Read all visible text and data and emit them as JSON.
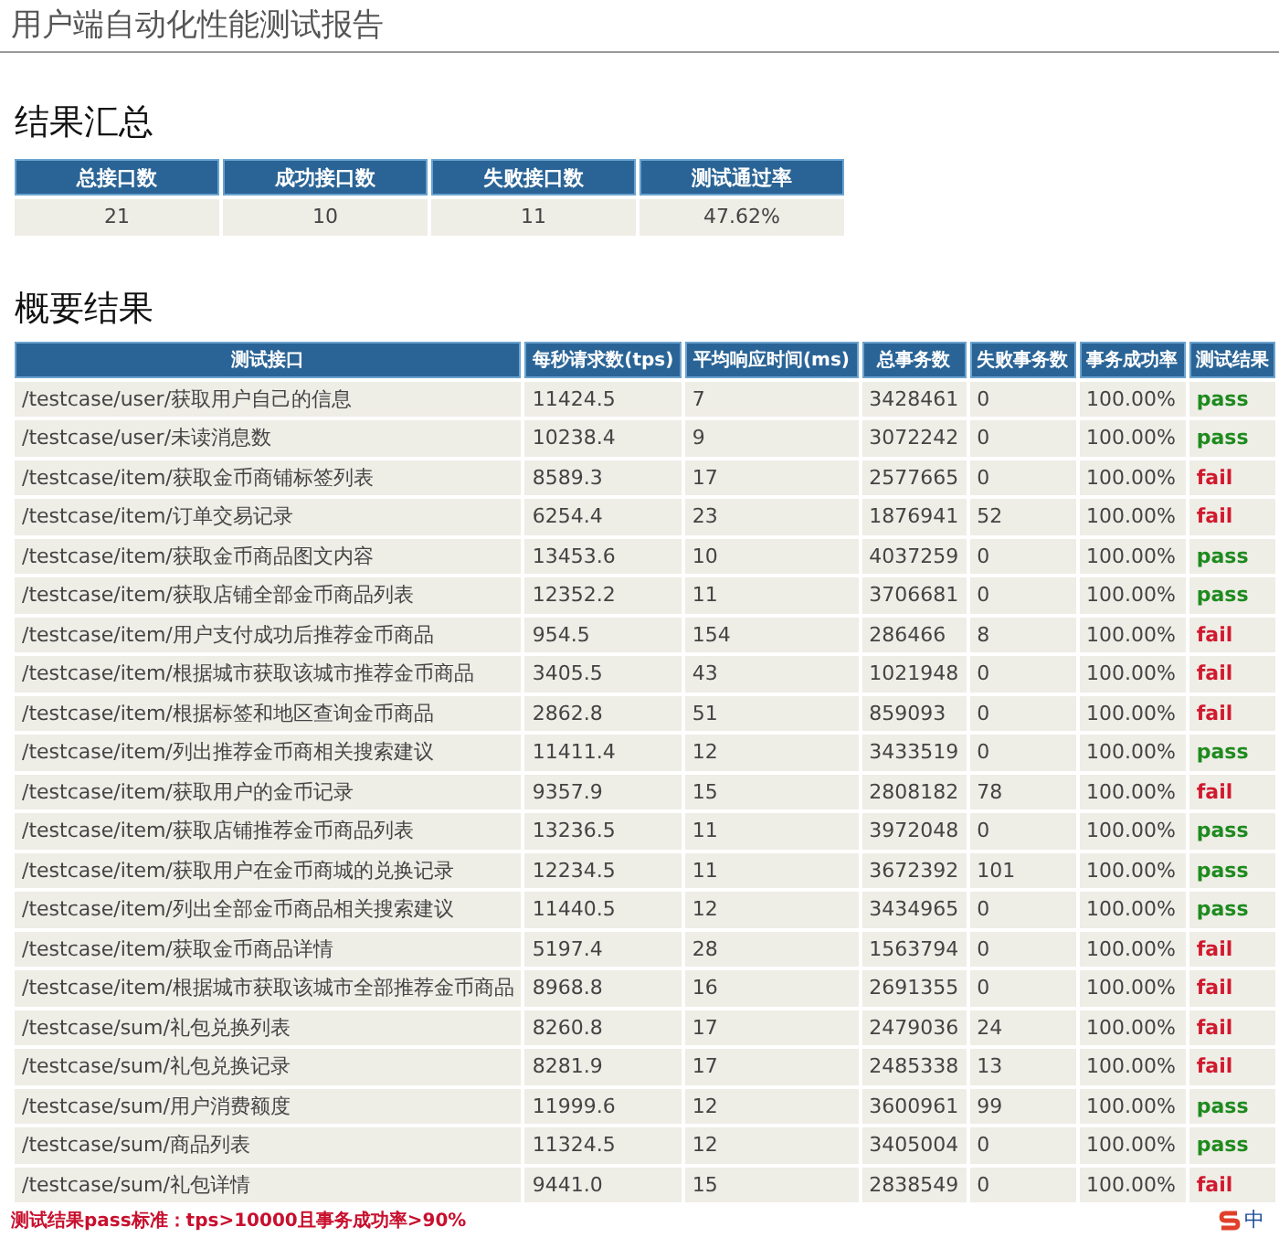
{
  "title": "用户端自动化性能测试报告",
  "summary": {
    "heading": "结果汇总",
    "columns": [
      "总接口数",
      "成功接口数",
      "失败接口数",
      "测试通过率"
    ],
    "values": [
      "21",
      "10",
      "11",
      "47.62%"
    ]
  },
  "details": {
    "heading": "概要结果",
    "columns": [
      "测试接口",
      "每秒请求数(tps)",
      "平均响应时间(ms)",
      "总事务数",
      "失败事务数",
      "事务成功率",
      "测试结果"
    ],
    "rows": [
      {
        "cells": [
          "/testcase/user/获取用户自己的信息",
          "11424.5",
          "7",
          "3428461",
          "0",
          "100.00%"
        ],
        "result": "pass",
        "passed": true
      },
      {
        "cells": [
          "/testcase/user/未读消息数",
          "10238.4",
          "9",
          "3072242",
          "0",
          "100.00%"
        ],
        "result": "pass",
        "passed": true
      },
      {
        "cells": [
          "/testcase/item/获取金币商铺标签列表",
          "8589.3",
          "17",
          "2577665",
          "0",
          "100.00%"
        ],
        "result": "fail",
        "passed": false
      },
      {
        "cells": [
          "/testcase/item/订单交易记录",
          "6254.4",
          "23",
          "1876941",
          "52",
          "100.00%"
        ],
        "result": "fail",
        "passed": false
      },
      {
        "cells": [
          "/testcase/item/获取金币商品图文内容",
          "13453.6",
          "10",
          "4037259",
          "0",
          "100.00%"
        ],
        "result": "pass",
        "passed": true
      },
      {
        "cells": [
          "/testcase/item/获取店铺全部金币商品列表",
          "12352.2",
          "11",
          "3706681",
          "0",
          "100.00%"
        ],
        "result": "pass",
        "passed": true
      },
      {
        "cells": [
          "/testcase/item/用户支付成功后推荐金币商品",
          "954.5",
          "154",
          "286466",
          "8",
          "100.00%"
        ],
        "result": "fail",
        "passed": false
      },
      {
        "cells": [
          "/testcase/item/根据城市获取该城市推荐金币商品",
          "3405.5",
          "43",
          "1021948",
          "0",
          "100.00%"
        ],
        "result": "fail",
        "passed": false
      },
      {
        "cells": [
          "/testcase/item/根据标签和地区查询金币商品",
          "2862.8",
          "51",
          "859093",
          "0",
          "100.00%"
        ],
        "result": "fail",
        "passed": false
      },
      {
        "cells": [
          "/testcase/item/列出推荐金币商相关搜索建议",
          "11411.4",
          "12",
          "3433519",
          "0",
          "100.00%"
        ],
        "result": "pass",
        "passed": true
      },
      {
        "cells": [
          "/testcase/item/获取用户的金币记录",
          "9357.9",
          "15",
          "2808182",
          "78",
          "100.00%"
        ],
        "result": "fail",
        "passed": false
      },
      {
        "cells": [
          "/testcase/item/获取店铺推荐金币商品列表",
          "13236.5",
          "11",
          "3972048",
          "0",
          "100.00%"
        ],
        "result": "pass",
        "passed": true
      },
      {
        "cells": [
          "/testcase/item/获取用户在金币商城的兑换记录",
          "12234.5",
          "11",
          "3672392",
          "101",
          "100.00%"
        ],
        "result": "pass",
        "passed": true
      },
      {
        "cells": [
          "/testcase/item/列出全部金币商品相关搜索建议",
          "11440.5",
          "12",
          "3434965",
          "0",
          "100.00%"
        ],
        "result": "pass",
        "passed": true
      },
      {
        "cells": [
          "/testcase/item/获取金币商品详情",
          "5197.4",
          "28",
          "1563794",
          "0",
          "100.00%"
        ],
        "result": "fail",
        "passed": false
      },
      {
        "cells": [
          "/testcase/item/根据城市获取该城市全部推荐金币商品",
          "8968.8",
          "16",
          "2691355",
          "0",
          "100.00%"
        ],
        "result": "fail",
        "passed": false
      },
      {
        "cells": [
          "/testcase/sum/礼包兑换列表",
          "8260.8",
          "17",
          "2479036",
          "24",
          "100.00%"
        ],
        "result": "fail",
        "passed": false
      },
      {
        "cells": [
          "/testcase/sum/礼包兑换记录",
          "8281.9",
          "17",
          "2485338",
          "13",
          "100.00%"
        ],
        "result": "fail",
        "passed": false
      },
      {
        "cells": [
          "/testcase/sum/用户消费额度",
          "11999.6",
          "12",
          "3600961",
          "99",
          "100.00%"
        ],
        "result": "pass",
        "passed": true
      },
      {
        "cells": [
          "/testcase/sum/商品列表",
          "11324.5",
          "12",
          "3405004",
          "0",
          "100.00%"
        ],
        "result": "pass",
        "passed": true
      },
      {
        "cells": [
          "/testcase/sum/礼包详情",
          "9441.0",
          "15",
          "2838549",
          "0",
          "100.00%"
        ],
        "result": "fail",
        "passed": false
      }
    ]
  },
  "note": "测试结果pass标准：tps>10000且事务成功率>90%",
  "ime": {
    "label": "中"
  }
}
